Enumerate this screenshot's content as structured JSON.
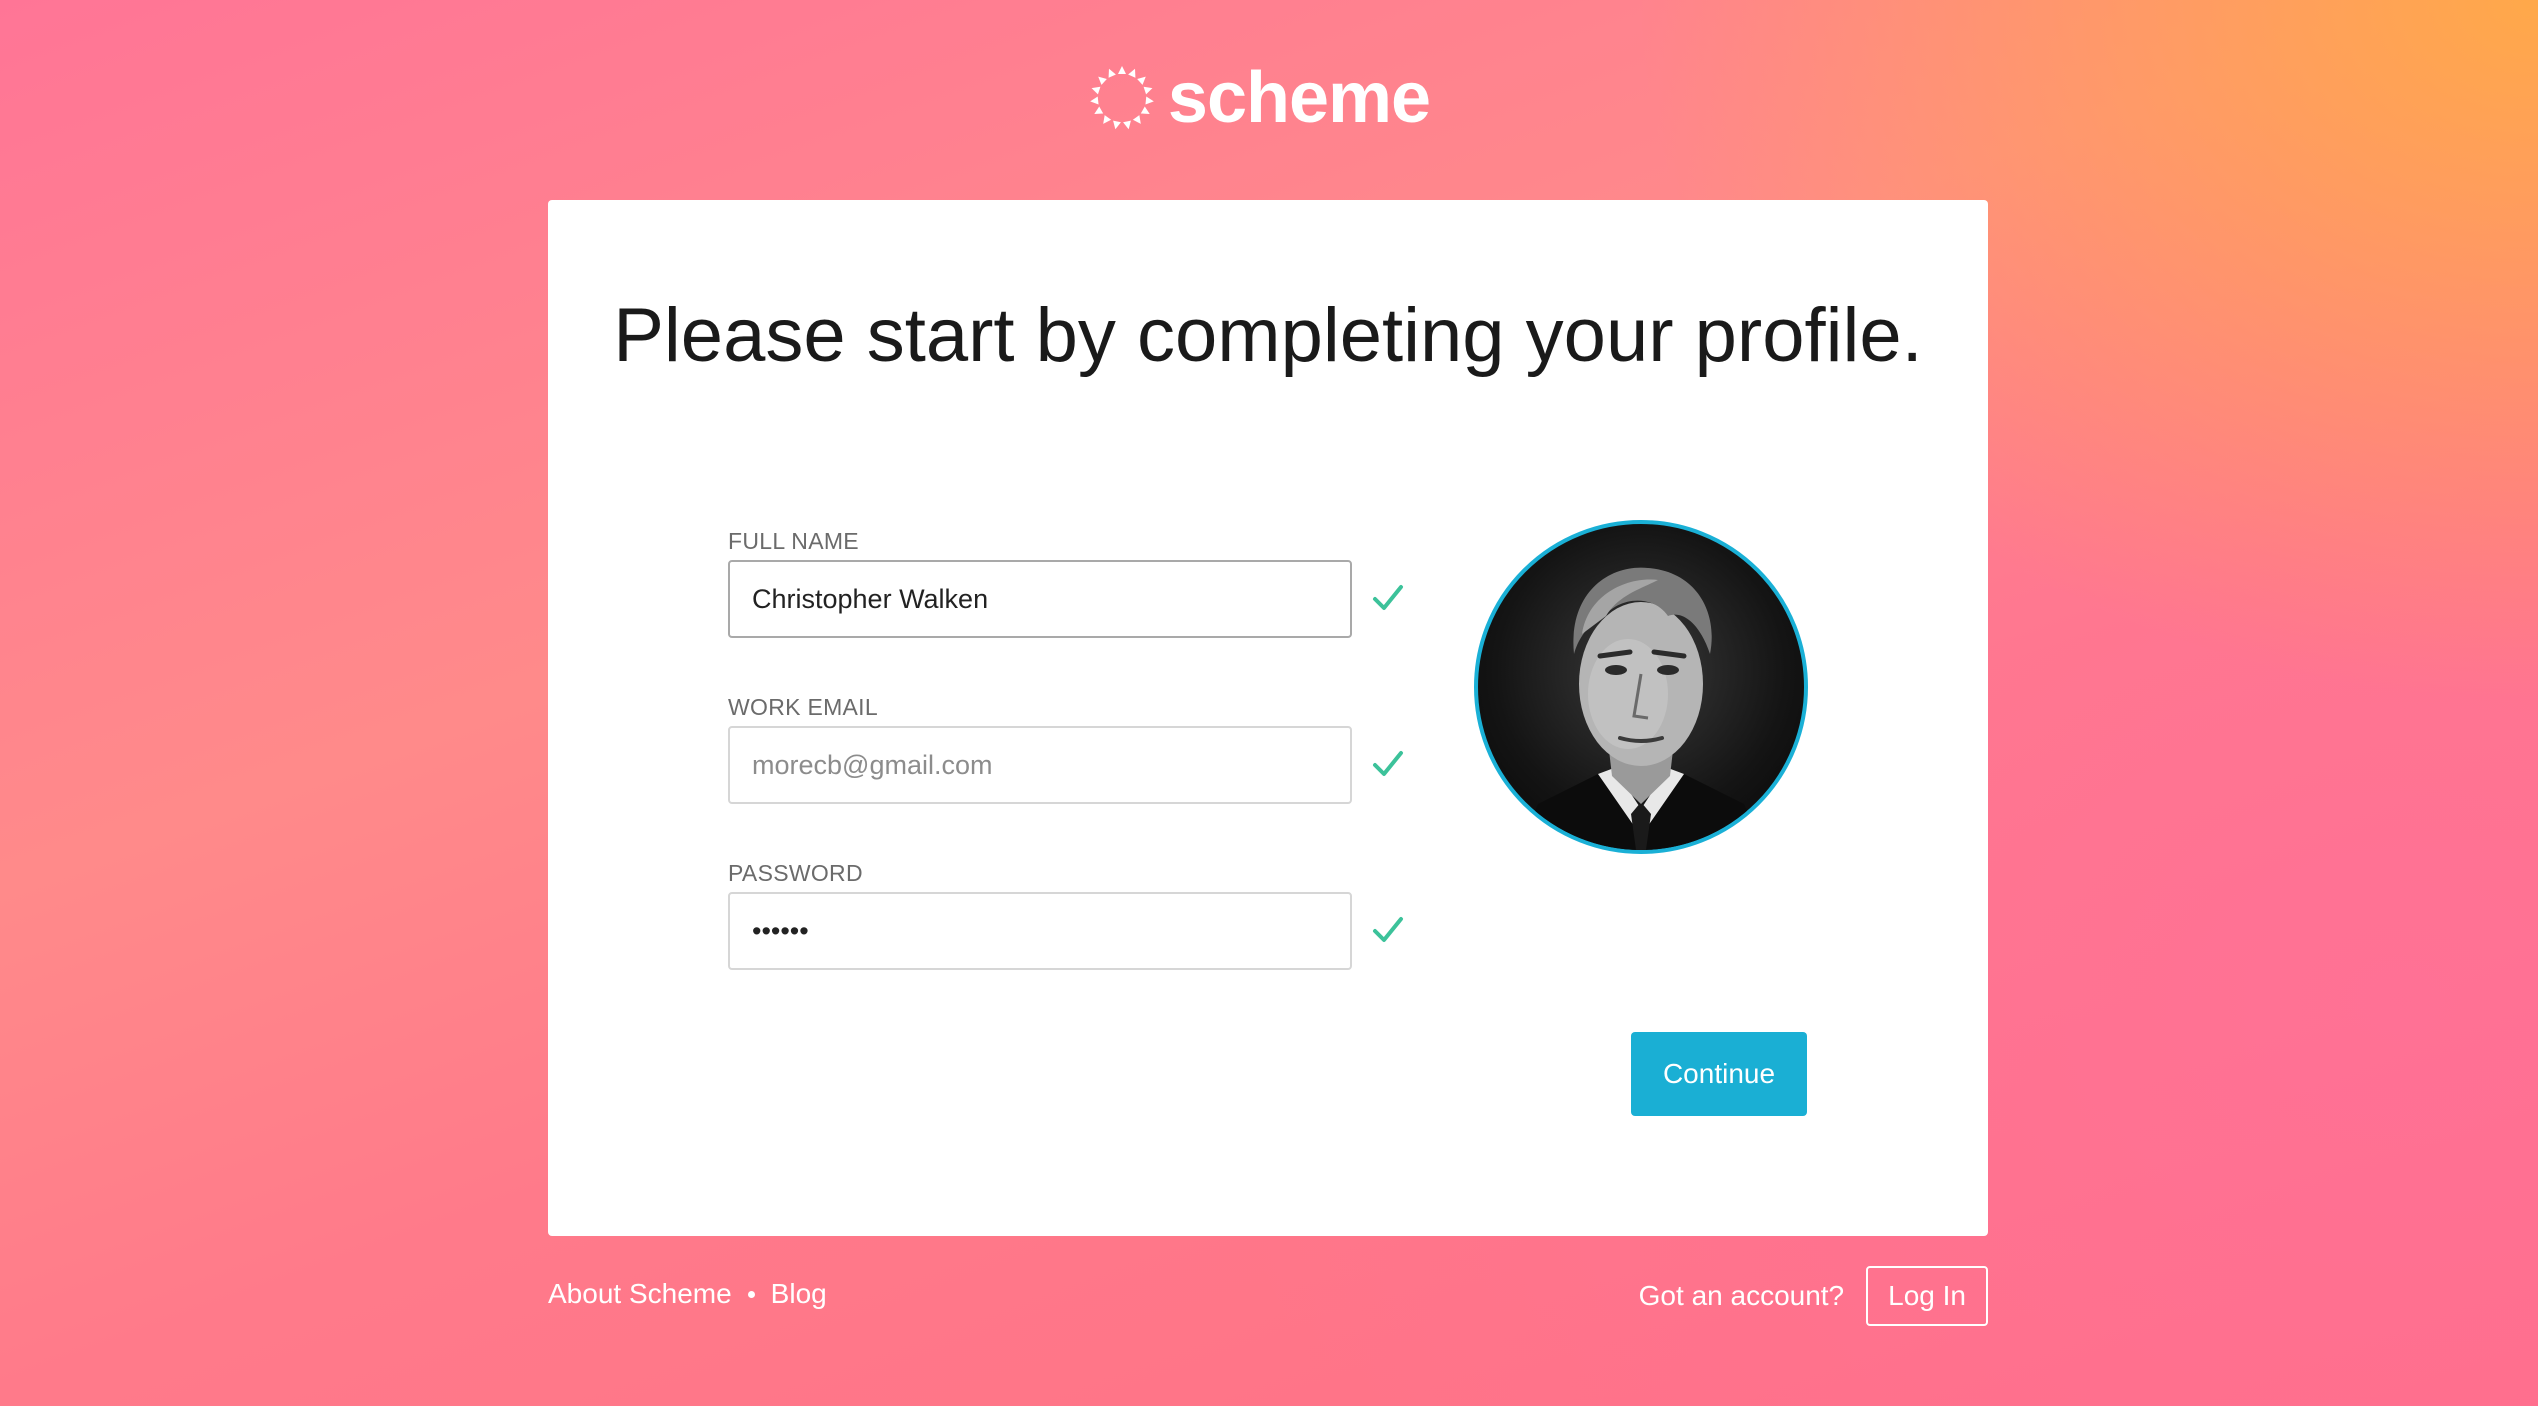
{
  "brand": {
    "name": "scheme",
    "logo_icon": "sunburst-ring-icon"
  },
  "card": {
    "heading": "Please start by completing your profile.",
    "fields": {
      "full_name": {
        "label": "FULL NAME",
        "value": "Christopher Walken",
        "status_icon": "check-icon"
      },
      "work_email": {
        "label": "WORK EMAIL",
        "placeholder": "morecb@gmail.com",
        "status_icon": "check-icon"
      },
      "password": {
        "label": "PASSWORD",
        "value": "••••••",
        "status_icon": "check-icon"
      }
    },
    "continue_label": "Continue"
  },
  "footer": {
    "about_label": "About Scheme",
    "blog_label": "Blog",
    "account_prompt": "Got an account?",
    "login_label": "Log In"
  },
  "colors": {
    "accent": "#1aafd4",
    "check": "#3cc29a",
    "background_pink": "#ff7a8a",
    "background_orange": "#ffaa46"
  }
}
